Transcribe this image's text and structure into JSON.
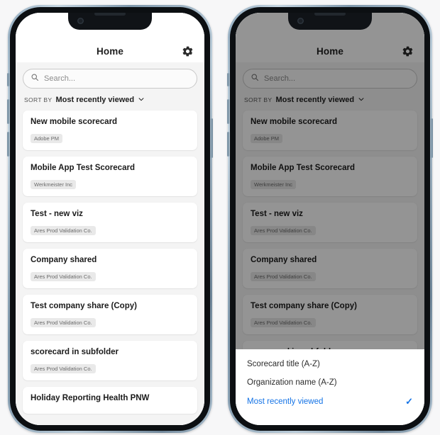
{
  "app": {
    "header": {
      "title": "Home",
      "settings_icon": "gear-icon"
    },
    "search": {
      "placeholder": "Search...",
      "value": "",
      "icon": "search-icon"
    },
    "sort": {
      "label": "SORT BY",
      "value": "Most recently viewed",
      "chevron_icon": "chevron-down-icon"
    },
    "scorecards": [
      {
        "title": "New mobile scorecard",
        "organization": "Adobe PM"
      },
      {
        "title": "Mobile App Test Scorecard",
        "organization": "Werkmeister Inc"
      },
      {
        "title": "Test - new viz",
        "organization": "Ares Prod Validation Co."
      },
      {
        "title": "Company shared",
        "organization": "Ares Prod Validation Co."
      },
      {
        "title": "Test company share (Copy)",
        "organization": "Ares Prod Validation Co."
      },
      {
        "title": "scorecard in subfolder",
        "organization": "Ares Prod Validation Co."
      },
      {
        "title": "Holiday Reporting Health PNW",
        "organization": ""
      }
    ]
  },
  "sort_sheet": {
    "options": [
      {
        "label": "Scorecard title (A-Z)",
        "selected": false
      },
      {
        "label": "Organization name (A-Z)",
        "selected": false
      },
      {
        "label": "Most recently viewed",
        "selected": true
      }
    ],
    "check_glyph": "✓"
  },
  "colors": {
    "accent": "#1473e6",
    "page_background": "#f7f7f8",
    "app_background": "#f4f4f4",
    "card_background": "#ffffff",
    "tag_background": "#e9e9e9",
    "scrim": "rgba(0,0,0,0.42)"
  }
}
